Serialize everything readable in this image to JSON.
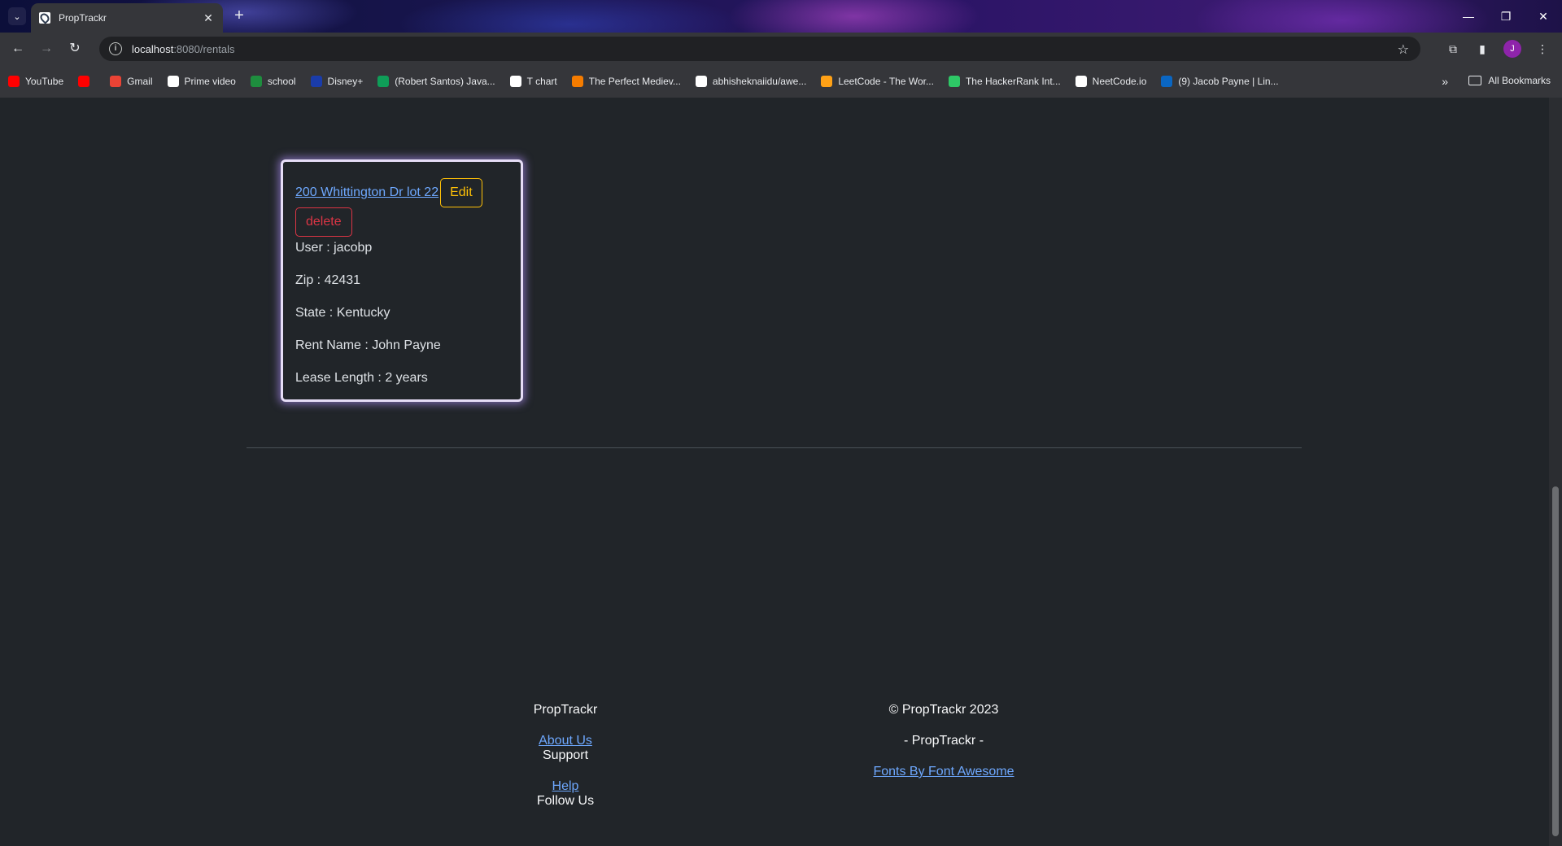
{
  "browser": {
    "tab_title": "PropTrackr",
    "url_host": "localhost",
    "url_rest": ":8080/rentals",
    "avatar_letter": "J",
    "bookmarks": [
      {
        "label": "YouTube",
        "color": "#ff0000"
      },
      {
        "label": "",
        "color": "#ff0000"
      },
      {
        "label": "Gmail",
        "color": "#ea4335"
      },
      {
        "label": "Prime video",
        "color": "#ffffff"
      },
      {
        "label": "school",
        "color": "#1e8e3e"
      },
      {
        "label": "Disney+",
        "color": "#1a3caa"
      },
      {
        "label": "(Robert Santos) Java...",
        "color": "#0f9d58"
      },
      {
        "label": "T chart",
        "color": "#ffffff"
      },
      {
        "label": "The Perfect Mediev...",
        "color": "#f57c00"
      },
      {
        "label": "abhisheknaiidu/awe...",
        "color": "#ffffff"
      },
      {
        "label": "LeetCode - The Wor...",
        "color": "#ffa116"
      },
      {
        "label": "The HackerRank Int...",
        "color": "#2ec866"
      },
      {
        "label": "NeetCode.io",
        "color": "#ffffff"
      },
      {
        "label": "(9) Jacob Payne | Lin...",
        "color": "#0a66c2"
      }
    ],
    "all_bookmarks": "All Bookmarks"
  },
  "rental": {
    "address": "200 Whittington Dr lot 22",
    "edit_label": "Edit",
    "delete_label": "delete",
    "user": "User : jacobp",
    "zip": "Zip : 42431",
    "state": "State : Kentucky",
    "rent_name": "Rent Name : John Payne",
    "lease_length": "Lease Length : 2 years"
  },
  "footer": {
    "brand": "PropTrackr",
    "about": "About Us",
    "support": "Support",
    "help": "Help",
    "follow": "Follow Us",
    "copyright": "© PropTrackr 2023",
    "tagline": "- PropTrackr -",
    "fonts_credit": "Fonts By Font Awesome"
  }
}
